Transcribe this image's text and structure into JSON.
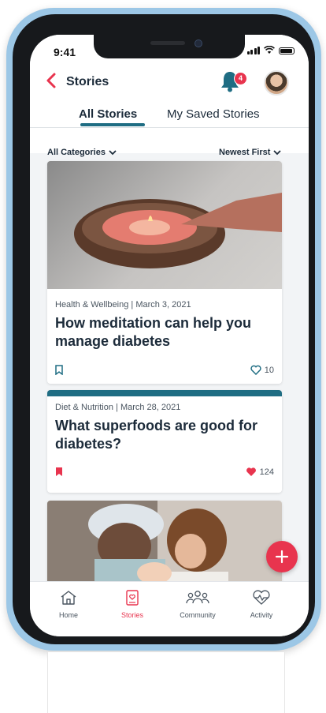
{
  "status_bar": {
    "time": "9:41"
  },
  "header": {
    "title": "Stories",
    "notification_count": "4"
  },
  "tabs": [
    {
      "label": "All Stories",
      "active": true
    },
    {
      "label": "My Saved Stories",
      "active": false
    }
  ],
  "filters": {
    "category": "All Categories",
    "sort": "Newest First"
  },
  "stories": [
    {
      "meta": "Health & Wellbeing | March 3, 2021",
      "title": "How meditation can help you manage diabetes",
      "likes": "10",
      "saved": false,
      "liked": false
    },
    {
      "meta": "Diet & Nutrition | March 28, 2021",
      "title": "What superfoods are good for diabetes?",
      "likes": "124",
      "saved": true,
      "liked": true
    }
  ],
  "fab": {
    "icon": "plus-icon"
  },
  "nav": [
    {
      "label": "Home",
      "icon": "home-icon"
    },
    {
      "label": "Stories",
      "icon": "stories-icon",
      "active": true
    },
    {
      "label": "Community",
      "icon": "community-icon"
    },
    {
      "label": "Activity",
      "icon": "activity-icon"
    }
  ],
  "colors": {
    "accent": "#e8344e",
    "brand": "#1f6d83",
    "text": "#1c2b3a",
    "frame": "#9cc7e6"
  }
}
